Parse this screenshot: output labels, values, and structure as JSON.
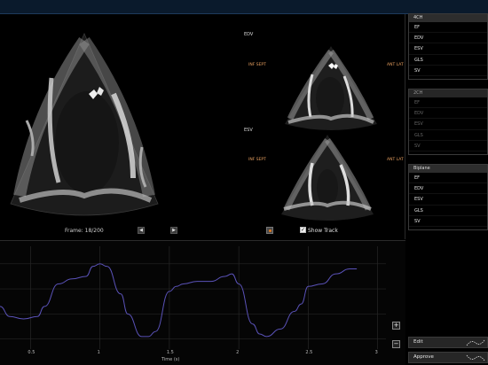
{
  "viewer": {
    "edv_label": "EDV",
    "esv_label": "ESV",
    "edv_left_label": "INF SEPT",
    "edv_right_label": "ANT LAT",
    "esv_left_label": "INF SEPT",
    "esv_right_label": "ANT LAT"
  },
  "controls": {
    "frame_text": "Frame: 18/200",
    "prev_icon": "◀",
    "next_icon": "▶",
    "show_track_label": "Show Track",
    "show_track_checked": true
  },
  "plot": {
    "x_ticks": [
      "0.5",
      "1",
      "1.5",
      "2",
      "2.5",
      "3"
    ],
    "x_label": "Time (s)",
    "zoom_in": "+",
    "zoom_out": "−",
    "line_color": "#5a52b8"
  },
  "panels": [
    {
      "title": "4CH",
      "items": [
        "EF",
        "EDV",
        "ESV",
        "GLS",
        "SV"
      ],
      "enabled": true
    },
    {
      "title": "2CH",
      "items": [
        "EF",
        "EDV",
        "ESV",
        "GLS",
        "SV"
      ],
      "enabled": false
    },
    {
      "title": "Biplane",
      "items": [
        "EF",
        "EDV",
        "ESV",
        "GLS",
        "SV"
      ],
      "enabled": true
    }
  ],
  "actions": {
    "edit_label": "Edit",
    "approve_label": "Approve"
  },
  "chart_data": {
    "type": "line",
    "x": [
      0.28,
      0.35,
      0.45,
      0.55,
      0.6,
      0.7,
      0.8,
      0.9,
      0.95,
      1.0,
      1.05,
      1.15,
      1.2,
      1.3,
      1.35,
      1.4,
      1.5,
      1.55,
      1.6,
      1.7,
      1.8,
      1.9,
      1.95,
      2.0,
      2.1,
      2.15,
      2.2,
      2.3,
      2.4,
      2.45,
      2.5,
      2.6,
      2.7,
      2.8,
      2.85
    ],
    "y": [
      -0.35,
      -0.55,
      -0.6,
      -0.55,
      -0.35,
      0.1,
      0.2,
      0.25,
      0.45,
      0.5,
      0.45,
      -0.1,
      -0.5,
      -0.95,
      -0.95,
      -0.85,
      -0.05,
      0.05,
      0.1,
      0.15,
      0.15,
      0.25,
      0.3,
      0.1,
      -0.7,
      -0.9,
      -0.95,
      -0.8,
      -0.45,
      -0.3,
      0.05,
      0.1,
      0.3,
      0.4,
      0.4
    ],
    "xlabel": "Time (s)",
    "x_ticks": [
      0.5,
      1,
      1.5,
      2,
      2.5,
      3
    ],
    "xlim": [
      0.28,
      3.06
    ],
    "ylim": [
      -1.2,
      0.85
    ],
    "grid": true
  }
}
